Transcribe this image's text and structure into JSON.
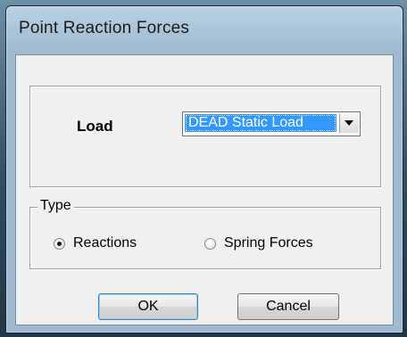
{
  "window": {
    "title": "Point Reaction Forces"
  },
  "load": {
    "label": "Load",
    "selected": "DEAD Static Load"
  },
  "type": {
    "legend": "Type",
    "options": [
      {
        "label": "Reactions",
        "checked": true
      },
      {
        "label": "Spring Forces",
        "checked": false
      }
    ]
  },
  "buttons": {
    "ok": "OK",
    "cancel": "Cancel"
  },
  "icons": {
    "dropdown": "chevron-down-icon"
  }
}
